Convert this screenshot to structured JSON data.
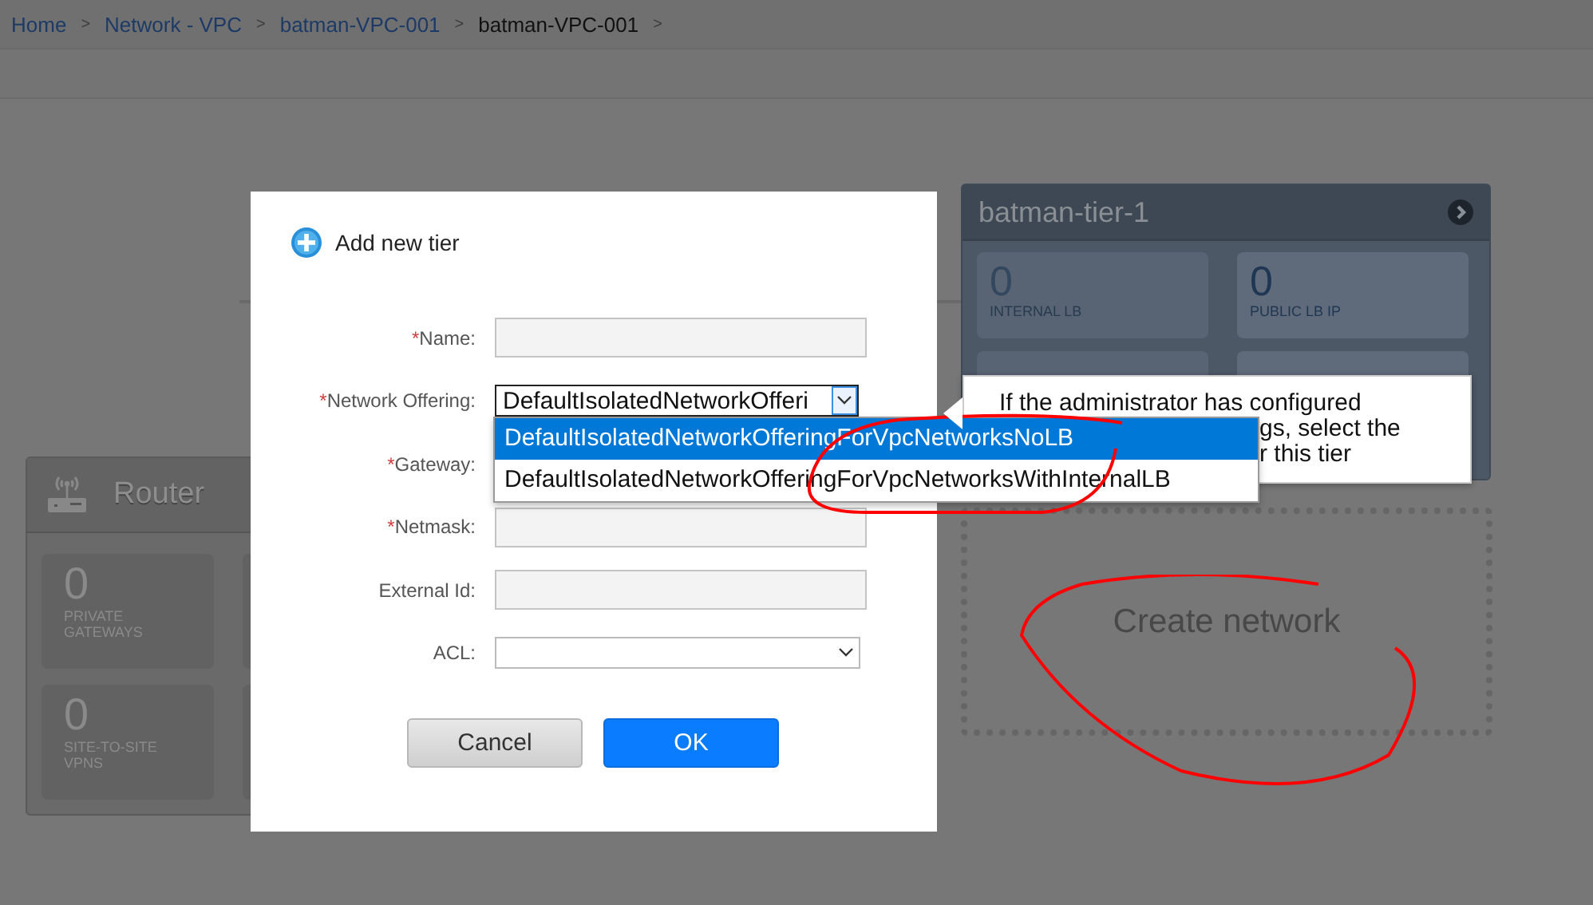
{
  "breadcrumb": {
    "separator": ">",
    "items": [
      {
        "label": "Home",
        "current": false
      },
      {
        "label": "Network - VPC",
        "current": false
      },
      {
        "label": "batman-VPC-001",
        "current": false
      },
      {
        "label": "batman-VPC-001",
        "current": true
      }
    ]
  },
  "router": {
    "title": "Router",
    "stats": [
      {
        "value": "0",
        "label": "PRIVATE GATEWAYS"
      },
      {
        "value": "0",
        "label": "SITE-TO-SITE VPNS"
      }
    ]
  },
  "tier": {
    "title": "batman-tier-1",
    "stats": [
      {
        "value": "0",
        "label": "INTERNAL LB"
      },
      {
        "value": "0",
        "label": "PUBLIC LB IP"
      }
    ]
  },
  "create_network": {
    "label": "Create network"
  },
  "dialog": {
    "title": "Add new tier",
    "fields": [
      {
        "label": "Name:",
        "mark": "*",
        "kind": "text"
      },
      {
        "label": "Network Offering:",
        "mark": "*",
        "kind": "select",
        "value": "DefaultIsolatedNetworkOfferi"
      },
      {
        "label": "Gateway:",
        "mark": "*",
        "kind": "covered"
      },
      {
        "label": "Netmask:",
        "mark": "*",
        "kind": "text"
      },
      {
        "label": "External Id:",
        "kind": "text"
      },
      {
        "label": "ACL:",
        "kind": "select"
      }
    ],
    "buttons": [
      {
        "label": "Cancel",
        "kind": "secondary"
      },
      {
        "label": "OK",
        "kind": "primary"
      }
    ]
  },
  "dropdown": {
    "options": [
      {
        "label": "DefaultIsolatedNetworkOfferingForVpcNetworksNoLB",
        "selected": true
      },
      {
        "label": "DefaultIsolatedNetworkOfferingForVpcNetworksWithInternalLB",
        "selected": false
      }
    ]
  },
  "tooltip": {
    "lines": [
      "If the administrator has configured",
      "gs, select the",
      "r this tier"
    ]
  }
}
